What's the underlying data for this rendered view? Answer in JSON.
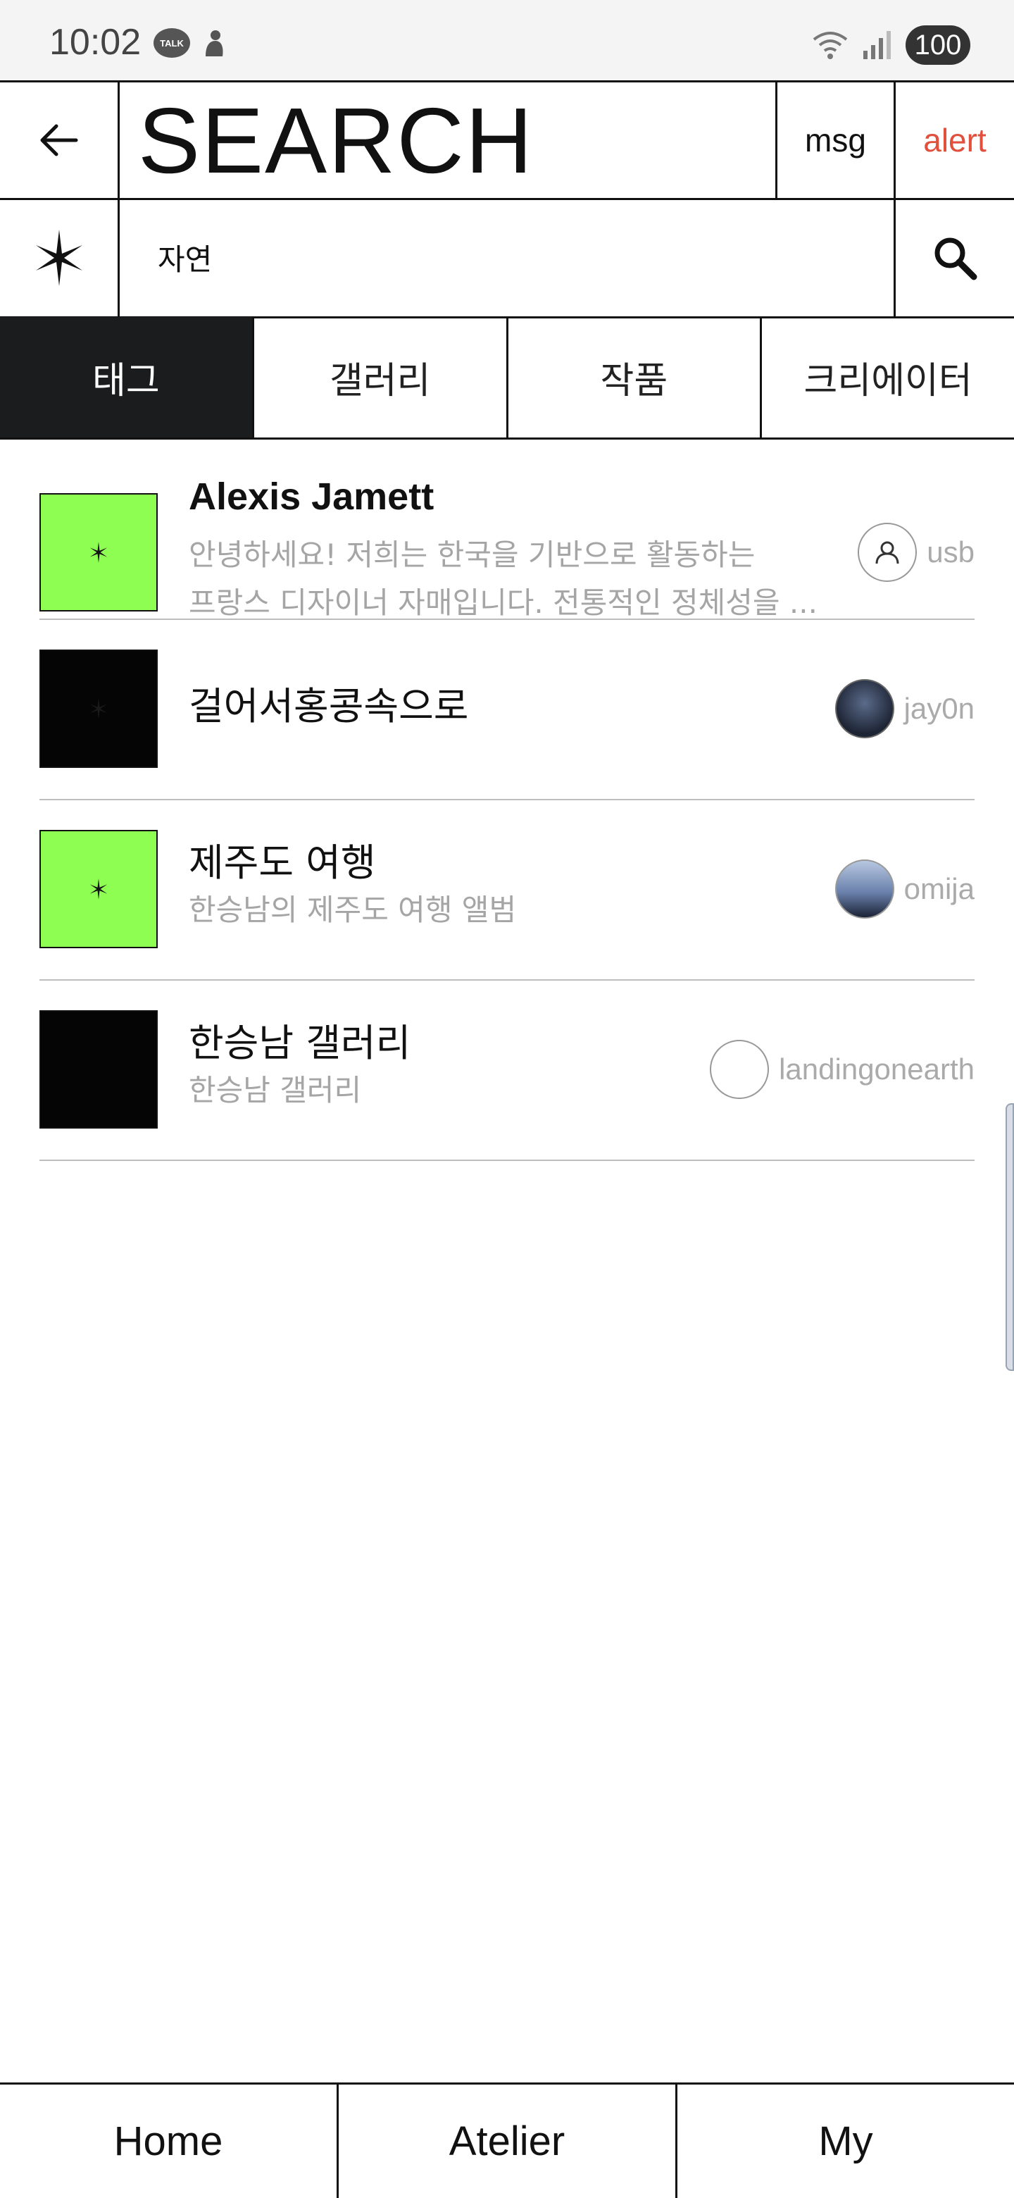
{
  "status_bar": {
    "time": "10:02",
    "talk_badge": "TALK",
    "battery": "100"
  },
  "header": {
    "title": "SEARCH",
    "msg_label": "msg",
    "alert_label": "alert"
  },
  "search": {
    "query": "자연"
  },
  "tabs": [
    {
      "label": "태그",
      "active": true
    },
    {
      "label": "갤러리",
      "active": false
    },
    {
      "label": "작품",
      "active": false
    },
    {
      "label": "크리에이터",
      "active": false
    }
  ],
  "results": [
    {
      "title": "Alexis Jamett",
      "description_line1": "안녕하세요! 저희는 한국을 기반으로 활동하는",
      "description_line2": "프랑스 디자이너 자매입니다. 전통적인 정체성을 ...",
      "creator": "usb",
      "thumb": "green"
    },
    {
      "title": "걸어서홍콩속으로",
      "description": "",
      "creator": "jay0n",
      "thumb": "black"
    },
    {
      "title": "제주도 여행",
      "description": "한승남의 제주도 여행 앨범",
      "creator": "omija",
      "thumb": "green"
    },
    {
      "title": "한승남 갤러리",
      "description": "한승남 갤러리",
      "creator": "landingonearth",
      "thumb": "black"
    }
  ],
  "bottom_nav": [
    {
      "label": "Home"
    },
    {
      "label": "Atelier"
    },
    {
      "label": "My"
    }
  ],
  "colors": {
    "accent_green": "#8efe52",
    "alert_red": "#e0503c",
    "active_tab": "#1b1c1e"
  }
}
